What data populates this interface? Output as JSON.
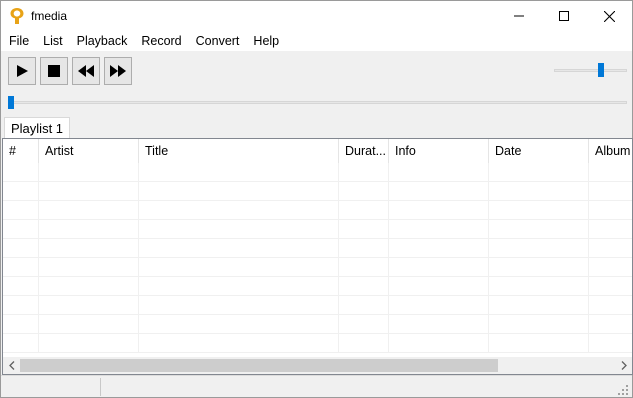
{
  "window": {
    "title": "fmedia",
    "icon": "fmedia-logo-icon",
    "accent_color": "#e8a317",
    "controls": [
      "minimize-icon",
      "maximize-icon",
      "close-icon"
    ]
  },
  "menu": [
    "File",
    "List",
    "Playback",
    "Record",
    "Convert",
    "Help"
  ],
  "toolbar": {
    "buttons": [
      "play-icon",
      "stop-icon",
      "rewind-icon",
      "fast-forward-icon"
    ],
    "volume_level": 0.65,
    "seek_position": 0.0,
    "slider_color": "#0078d7"
  },
  "tabs": [
    "Playlist 1"
  ],
  "playlist": {
    "columns": [
      "#",
      "Artist",
      "Title",
      "Durat...",
      "Info",
      "Date",
      "Album"
    ],
    "rows": []
  },
  "statusbar": {
    "pane1": "",
    "pane2": ""
  }
}
